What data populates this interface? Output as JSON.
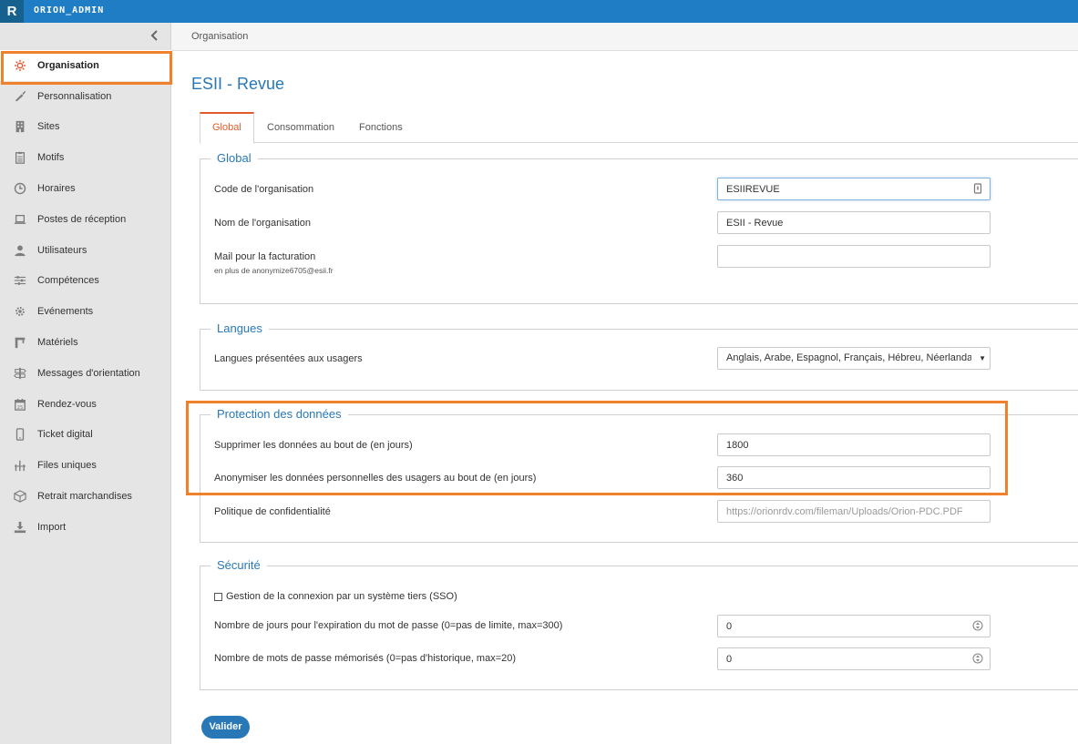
{
  "app": {
    "logo": "R",
    "title": "ORION_ADMIN"
  },
  "breadcrumb": "Organisation",
  "sidebar": {
    "collapse_icon": "chevron-left-icon",
    "items": [
      {
        "label": "Organisation",
        "icon": "gear-icon",
        "active": true
      },
      {
        "label": "Personnalisation",
        "icon": "brush-icon"
      },
      {
        "label": "Sites",
        "icon": "building-icon"
      },
      {
        "label": "Motifs",
        "icon": "clipboard-icon"
      },
      {
        "label": "Horaires",
        "icon": "clock-icon"
      },
      {
        "label": "Postes de réception",
        "icon": "laptop-icon"
      },
      {
        "label": "Utilisateurs",
        "icon": "user-icon"
      },
      {
        "label": "Compétences",
        "icon": "sliders-icon"
      },
      {
        "label": "Evénements",
        "icon": "cog-icon"
      },
      {
        "label": "Matériels",
        "icon": "tool-icon"
      },
      {
        "label": "Messages d'orientation",
        "icon": "signpost-icon"
      },
      {
        "label": "Rendez-vous",
        "icon": "calendar-icon"
      },
      {
        "label": "Ticket digital",
        "icon": "phone-icon"
      },
      {
        "label": "Files uniques",
        "icon": "queue-icon"
      },
      {
        "label": "Retrait marchandises",
        "icon": "box-icon"
      },
      {
        "label": "Import",
        "icon": "download-icon"
      }
    ]
  },
  "page": {
    "title": "ESII - Revue"
  },
  "tabs": [
    {
      "label": "Global",
      "active": true
    },
    {
      "label": "Consommation"
    },
    {
      "label": "Fonctions"
    }
  ],
  "global": {
    "legend": "Global",
    "code_label": "Code de l'organisation",
    "code_value": "ESIIREVUE",
    "name_label": "Nom de l'organisation",
    "name_value": "ESII - Revue",
    "mail_label": "Mail pour la facturation",
    "mail_sub": "en plus de anonymize6705@esii.fr",
    "mail_value": ""
  },
  "langues": {
    "legend": "Langues",
    "label": "Langues présentées aux usagers",
    "selected": "Anglais, Arabe, Espagnol, Français, Hébreu, Néerlandais, Portugais"
  },
  "protection": {
    "legend": "Protection des données",
    "delete_label": "Supprimer les données au bout de (en jours)",
    "delete_value": "1800",
    "anon_label": "Anonymiser les données personnelles des usagers au bout de (en jours)",
    "anon_value": "360",
    "policy_label": "Politique de confidentialité",
    "policy_placeholder": "https://orionrdv.com/fileman/Uploads/Orion-PDC.PDF"
  },
  "securite": {
    "legend": "Sécurité",
    "sso_label": "Gestion de la connexion par un système tiers (SSO)",
    "sso_checked": false,
    "expiry_label": "Nombre de jours pour l'expiration du mot de passe (0=pas de limite, max=300)",
    "expiry_value": "0",
    "history_label": "Nombre de mots de passe mémorisés (0=pas d'historique, max=20)",
    "history_value": "0"
  },
  "actions": {
    "submit_label": "Valider"
  },
  "colors": {
    "brand": "#1f7dc5",
    "accent": "#e05b2b",
    "highlight": "#f0802a",
    "link": "#2878b7"
  }
}
